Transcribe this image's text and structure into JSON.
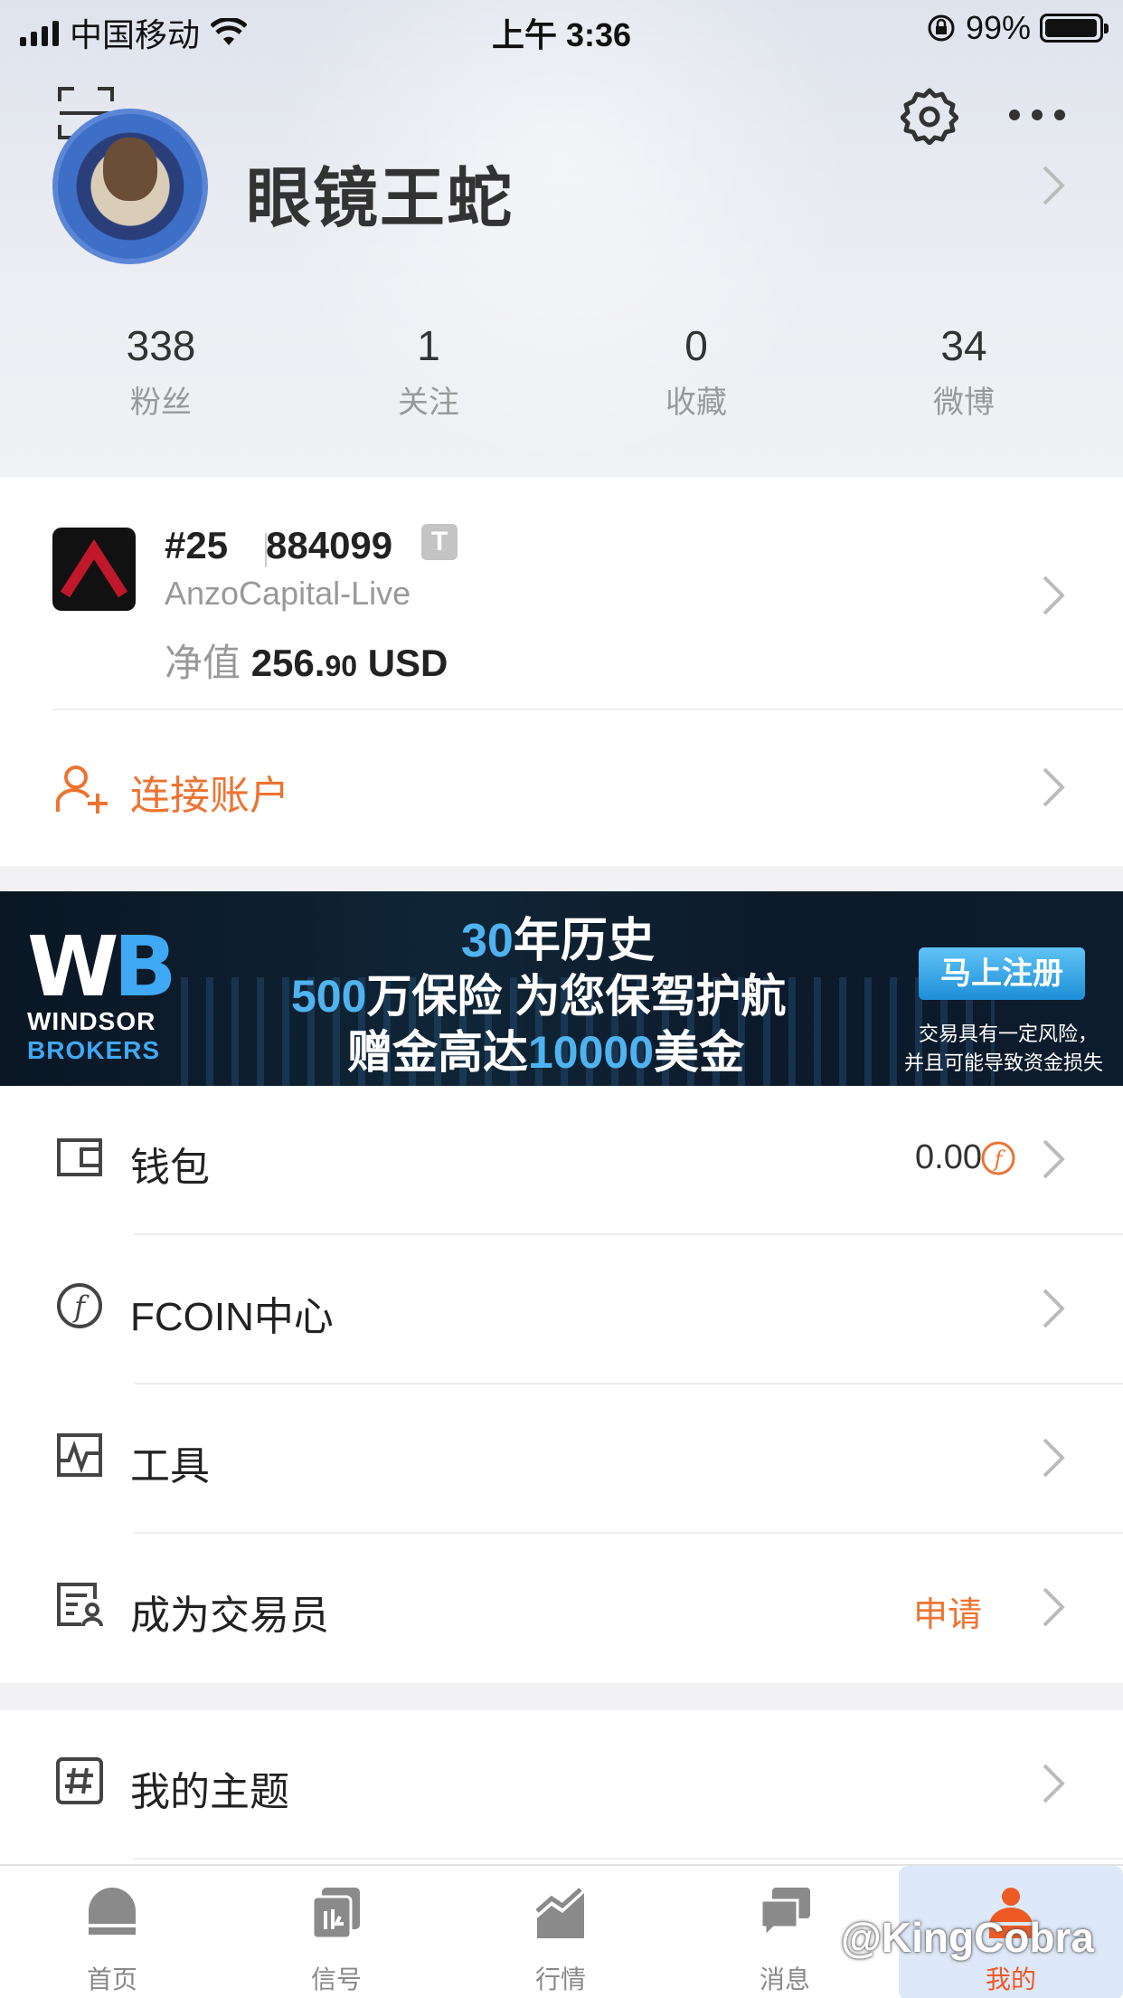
{
  "status_bar": {
    "carrier": "中国移动",
    "time": "上午 3:36",
    "battery": "99%"
  },
  "profile": {
    "name": "眼镜王蛇",
    "stats": [
      {
        "value": "338",
        "label": "粉丝"
      },
      {
        "value": "1",
        "label": "关注"
      },
      {
        "value": "0",
        "label": "收藏"
      },
      {
        "value": "34",
        "label": "微博"
      }
    ]
  },
  "account": {
    "rank": "#25",
    "id": "884099",
    "type_badge": "T",
    "broker": "AnzoCapital-Live",
    "equity_label": "净值",
    "equity_int": "256.",
    "equity_dec": "90",
    "equity_unit": "USD",
    "connect_label": "连接账户"
  },
  "banner": {
    "logo_line1": "WINDSOR",
    "logo_line2": "BROKERS",
    "line1_hl": "30",
    "line1": "年历史",
    "line2_hl": "500",
    "line2": "万保险 为您保驾护航",
    "line3_a": "赠金高达",
    "line3_hl": "10000",
    "line3_b": "美金",
    "button": "马上注册",
    "risk1": "交易具有一定风险，",
    "risk2": "并且可能导致资金损失"
  },
  "menu": {
    "wallet": {
      "label": "钱包",
      "value": "0.00"
    },
    "fcoin": {
      "label": "FCOIN中心"
    },
    "tools": {
      "label": "工具"
    },
    "trader": {
      "label": "成为交易员",
      "action": "申请"
    },
    "theme": {
      "label": "我的主题"
    }
  },
  "tabs": [
    {
      "label": "首页",
      "icon": "home-icon"
    },
    {
      "label": "信号",
      "icon": "signal-icon"
    },
    {
      "label": "行情",
      "icon": "market-icon"
    },
    {
      "label": "消息",
      "icon": "message-icon"
    },
    {
      "label": "我的",
      "icon": "profile-icon"
    }
  ],
  "watermark": "@KingCobra",
  "colors": {
    "accent": "#ee7331",
    "tab_active": "#ee5a24",
    "banner_blue": "#4fb3f0"
  }
}
